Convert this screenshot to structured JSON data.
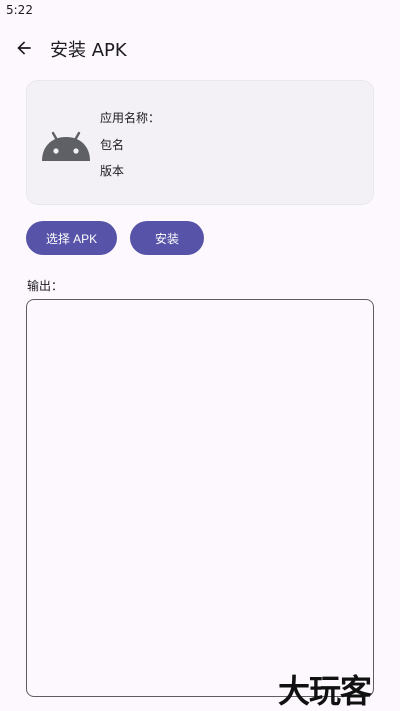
{
  "status_bar": {
    "time": "5:22"
  },
  "app_bar": {
    "title": "安装 APK"
  },
  "info": {
    "app_name_label": "应用名称：",
    "package_label": "包名",
    "version_label": "版本"
  },
  "actions": {
    "select_apk": "选择 APK",
    "install": "安装"
  },
  "output": {
    "label": "输出：",
    "value": ""
  },
  "watermark": "大玩客",
  "colors": {
    "primary": "#5753a8",
    "card": "#f3f1f6",
    "background": "#fdf8fd",
    "icon": "#5f6065"
  }
}
